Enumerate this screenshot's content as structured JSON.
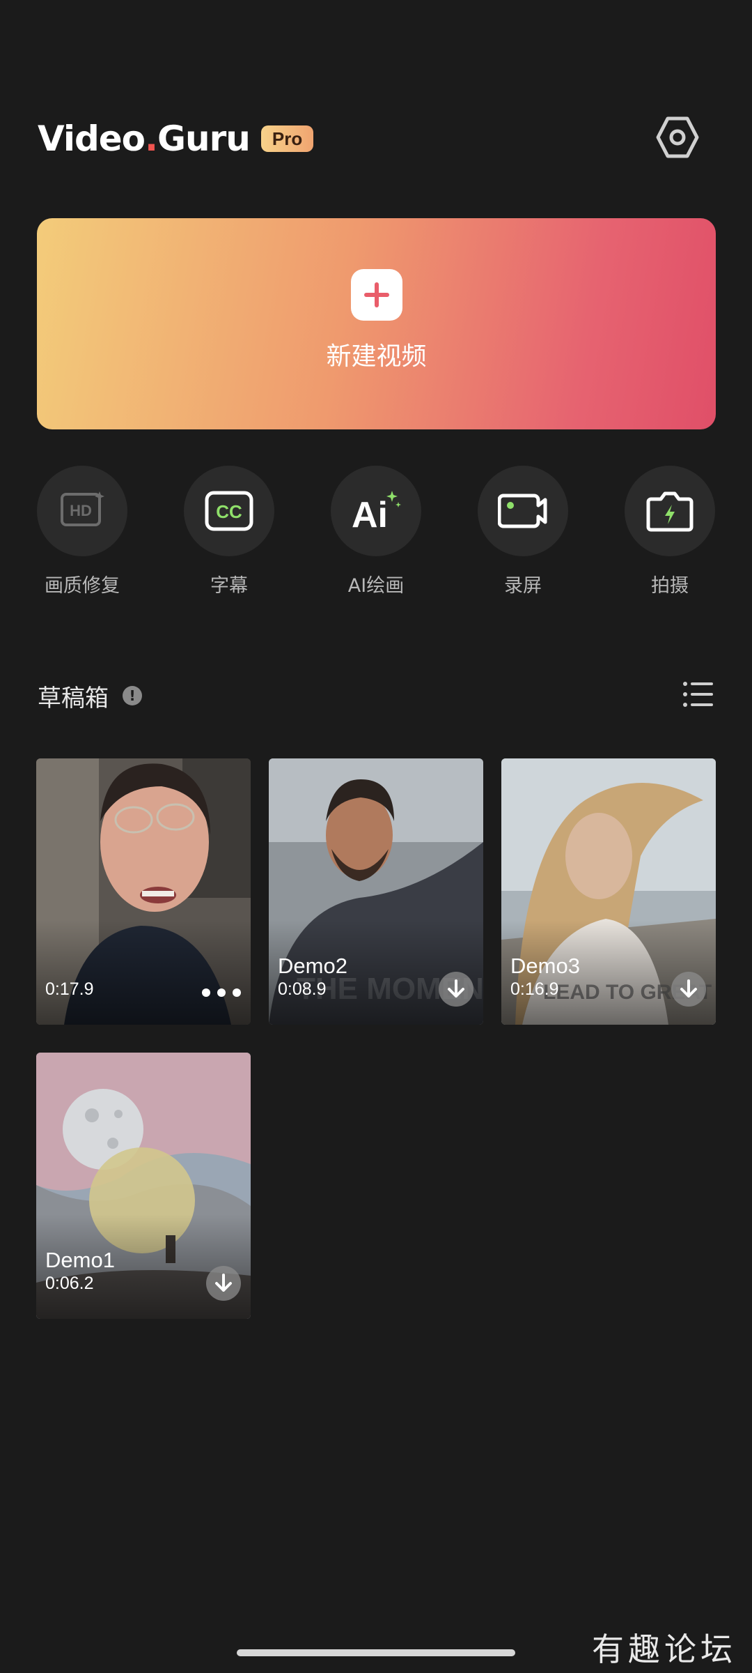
{
  "header": {
    "logo_text_1": "Video",
    "logo_text_2": "Guru",
    "pro_badge": "Pro",
    "settings_icon": "settings-hexagon-icon"
  },
  "create": {
    "label": "新建视频",
    "icon": "plus-icon",
    "gradient": [
      "#f3cc7a",
      "#ef9a6e",
      "#e66370",
      "#e04f68"
    ]
  },
  "tools": [
    {
      "label": "画质修复",
      "icon": "hd-icon"
    },
    {
      "label": "字幕",
      "icon": "cc-icon"
    },
    {
      "label": "AI绘画",
      "icon": "ai-icon"
    },
    {
      "label": "录屏",
      "icon": "screen-record-icon"
    },
    {
      "label": "拍摄",
      "icon": "camera-icon"
    }
  ],
  "drafts": {
    "title": "草稿箱",
    "info_icon": "!",
    "items": [
      {
        "name": "",
        "duration": "0:17.9",
        "action": "more"
      },
      {
        "name": "Demo2",
        "duration": "0:08.9",
        "action": "download"
      },
      {
        "name": "Demo3",
        "duration": "0:16.9",
        "action": "download"
      },
      {
        "name": "Demo1",
        "duration": "0:06.2",
        "action": "download"
      }
    ]
  },
  "watermark": "有趣论坛"
}
